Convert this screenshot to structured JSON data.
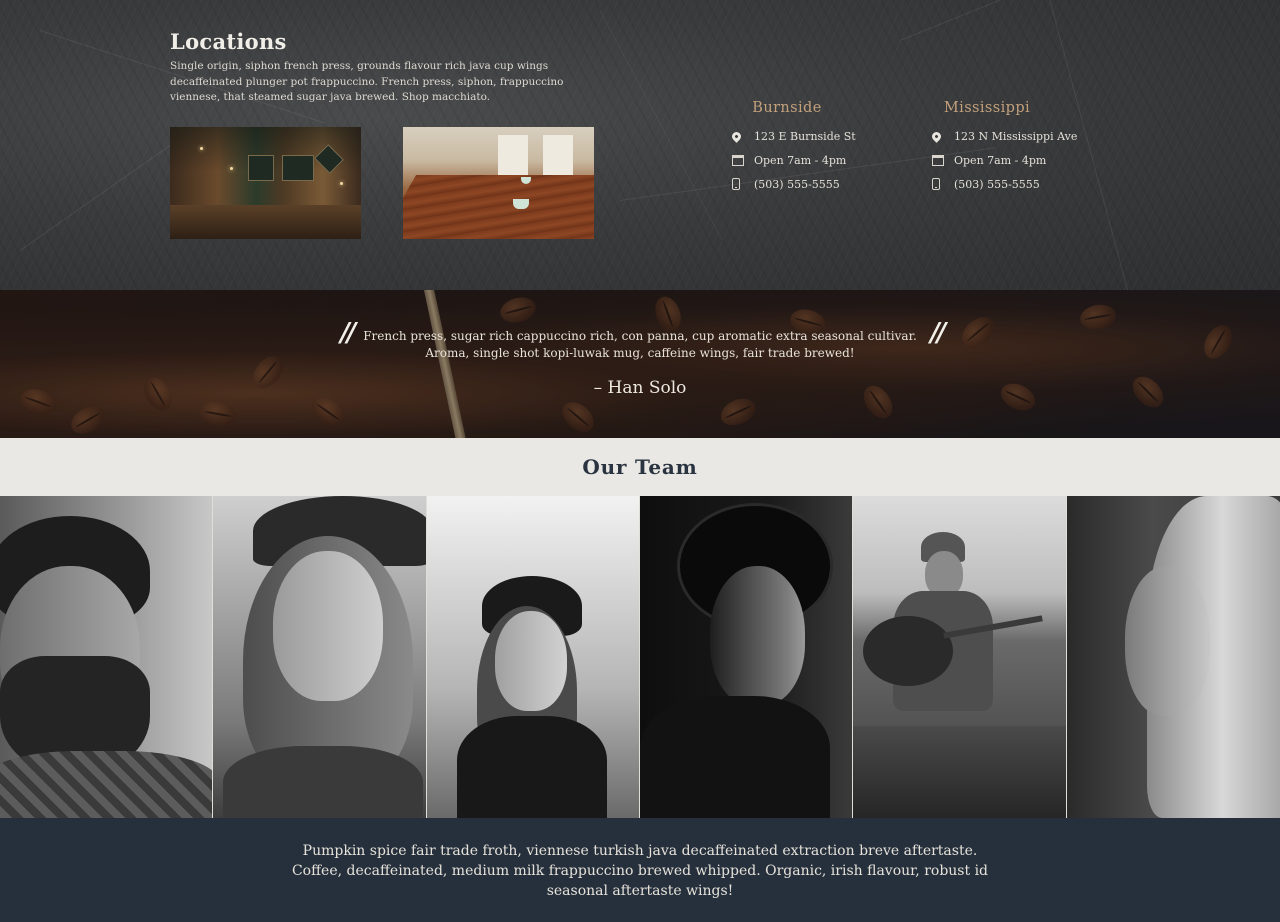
{
  "locations": {
    "title": "Locations",
    "description": "Single origin, siphon french press, grounds flavour rich java cup wings decaffeinated plunger pot frappuccino. French press, siphon, frappuccino viennese, that steamed sugar java brewed. Shop macchiato.",
    "branches": [
      {
        "name": "Burnside",
        "address": "123 E Burnside St",
        "hours": "Open 7am - 4pm",
        "phone": "(503) 555-5555"
      },
      {
        "name": "Mississippi",
        "address": "123 N Mississippi Ave",
        "hours": "Open 7am - 4pm",
        "phone": "(503) 555-5555"
      }
    ]
  },
  "quote": {
    "open_mark": "//",
    "close_mark": "//",
    "text": "French press, sugar rich cappuccino rich, con panna, cup aromatic extra seasonal cultivar. Aroma, single shot kopi-luwak mug, caffeine wings, fair trade brewed!",
    "author": "– Han Solo"
  },
  "team": {
    "title": "Our Team"
  },
  "footer": {
    "text": "Pumpkin spice fair trade froth, viennese turkish java decaffeinated extraction breve aftertaste. Coffee, decaffeinated, medium milk frappuccino brewed whipped. Organic, irish flavour, robust id seasonal aftertaste wings!"
  },
  "colors": {
    "branch_name": "#c2a07c",
    "team_header_bg": "#e9e8e4",
    "footer_bg": "#26303c",
    "team_title": "#2a3340"
  },
  "icons": {
    "address": "map-pin-icon",
    "hours": "calendar-icon",
    "phone": "mobile-phone-icon"
  }
}
